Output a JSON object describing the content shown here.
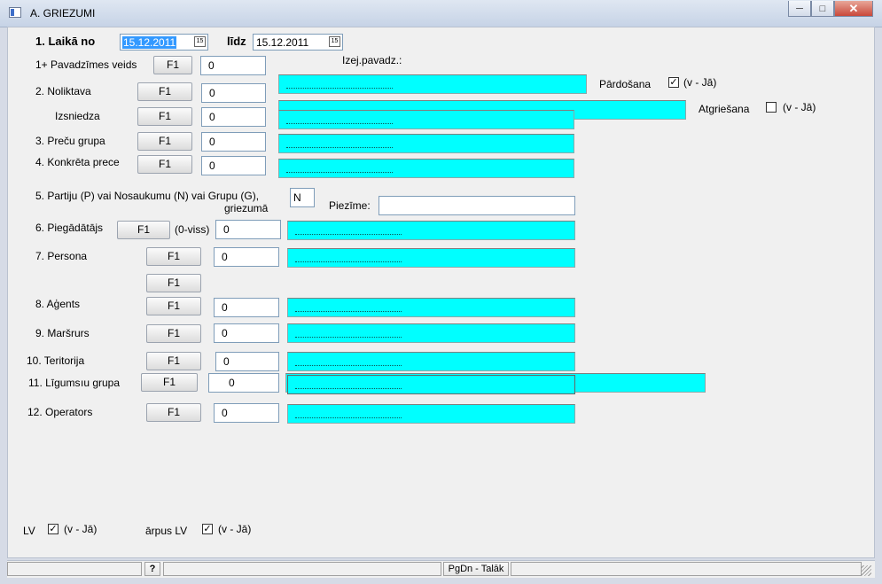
{
  "window": {
    "title": "A. GRIEZUMI",
    "controls": [
      "minimize",
      "maximize",
      "close"
    ]
  },
  "period": {
    "label_from": "1. Laikā no",
    "date_from": "15.12.2011",
    "label_to": "līdz",
    "date_to": "15.12.2011"
  },
  "f1": "F1",
  "rows": {
    "pavadzimes": {
      "label": "1+ Pavadzīmes veids",
      "value": "0",
      "right_label": "Izej.pavadz.:"
    },
    "noliktava": {
      "label": "2. Noliktava",
      "value": "0"
    },
    "izsniedza": {
      "label": "Izsniedza",
      "value": "0"
    },
    "precu_grupa": {
      "label": "3. Preču grupa",
      "value": "0"
    },
    "konkreta_prece": {
      "label": "4. Konkrēta prece",
      "value": "0"
    },
    "partiju": {
      "label": "5. Partiju (P) vai Nosaukumu (N) vai Grupu (G),",
      "label2": "griezumā",
      "value": "N",
      "piezime_label": "Piezīme:",
      "piezime_value": ""
    },
    "piegadatajs": {
      "label": "6. Piegādātājs",
      "hint": "(0-viss)",
      "value": "0"
    },
    "persona": {
      "label": "7. Persona",
      "value": "0"
    },
    "agents": {
      "label": "8. Aģents",
      "value": "0"
    },
    "marsruts": {
      "label": "9. Maršrurs",
      "value": "0"
    },
    "teritorija": {
      "label": "10.  Teritorija",
      "value": "0"
    },
    "ligums": {
      "label": "11. Līgums",
      "label_overlap": "ıu grupa",
      "value": "0"
    },
    "operators": {
      "label": "12. Operators",
      "value": "0"
    }
  },
  "options": {
    "pardosana": {
      "label": "Pārdošana",
      "hint": "(v - Jā)",
      "checked": true
    },
    "atgriesana": {
      "label": "Atgriešana",
      "hint": "(v - Jā)",
      "checked": false
    },
    "lv": {
      "label": "LV",
      "hint": "(v - Jā)",
      "checked": true
    },
    "arpus_lv": {
      "label": "ārpus LV",
      "hint": "(v - Jā)",
      "checked": true
    }
  },
  "statusbar": {
    "help": "?",
    "next": "PgDn - Talāk"
  },
  "colors": {
    "lookup_field": "#00ffff",
    "selection": "#3399ff"
  }
}
